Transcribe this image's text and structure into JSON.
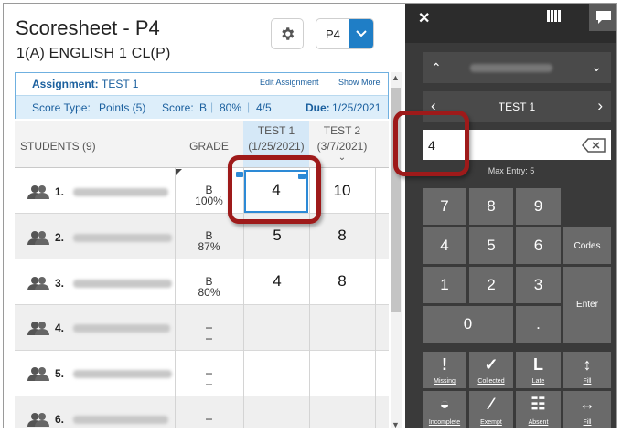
{
  "header": {
    "title": "Scoresheet - P4",
    "subtitle": "1(A) ENGLISH 1 CL(P)",
    "period_select": "P4"
  },
  "assignment": {
    "label": "Assignment:",
    "name": "TEST 1",
    "edit_link": "Edit Assignment",
    "show_more_link": "Show More",
    "score_type_label": "Score Type:",
    "score_type_value": "Points (5)",
    "score_label": "Score:",
    "score_grade": "B",
    "score_pct": "80%",
    "score_points": "4/5",
    "due_label": "Due:",
    "due_value": "1/25/2021"
  },
  "table": {
    "students_header": "STUDENTS (9)",
    "grade_header": "GRADE",
    "test1_header": "TEST 1",
    "test1_date": "(1/25/2021)",
    "test2_header": "TEST 2",
    "test2_date": "(3/7/2021)",
    "rows": [
      {
        "num": "1.",
        "grade": "B",
        "pct": "100%",
        "test1": "4",
        "test2": "10"
      },
      {
        "num": "2.",
        "grade": "B",
        "pct": "87%",
        "test1": "5",
        "test2": "8"
      },
      {
        "num": "3.",
        "grade": "B",
        "pct": "80%",
        "test1": "4",
        "test2": "8"
      },
      {
        "num": "4.",
        "grade": "--",
        "pct": "--",
        "test1": "",
        "test2": ""
      },
      {
        "num": "5.",
        "grade": "--",
        "pct": "--",
        "test1": "",
        "test2": ""
      },
      {
        "num": "6.",
        "grade": "--",
        "pct": "--",
        "test1": "",
        "test2": ""
      }
    ]
  },
  "panel": {
    "assignment_name": "TEST 1",
    "entry_value": "4",
    "max_entry": "Max Entry: 5",
    "keys": [
      "7",
      "8",
      "9",
      "4",
      "5",
      "6",
      "1",
      "2",
      "3",
      "0",
      "."
    ],
    "codes_label": "Codes",
    "enter_label": "Enter",
    "code_buttons": [
      {
        "label": "Missing",
        "icon": "!"
      },
      {
        "label": "Collected",
        "icon": "✓"
      },
      {
        "label": "Late",
        "icon": "L"
      },
      {
        "label": "Fill",
        "icon": "↕"
      },
      {
        "label": "Incomplete",
        "icon": "◒"
      },
      {
        "label": "Exempt",
        "icon": "∕"
      },
      {
        "label": "Absent",
        "icon": "☷"
      },
      {
        "label": "Fill",
        "icon": "↔"
      }
    ]
  },
  "colors": {
    "accent": "#1f7ec6",
    "callout": "#9e1a1a",
    "panel": "#3a3a3a",
    "key": "#6a6a6a",
    "assignment_text": "#1a5f9e"
  }
}
